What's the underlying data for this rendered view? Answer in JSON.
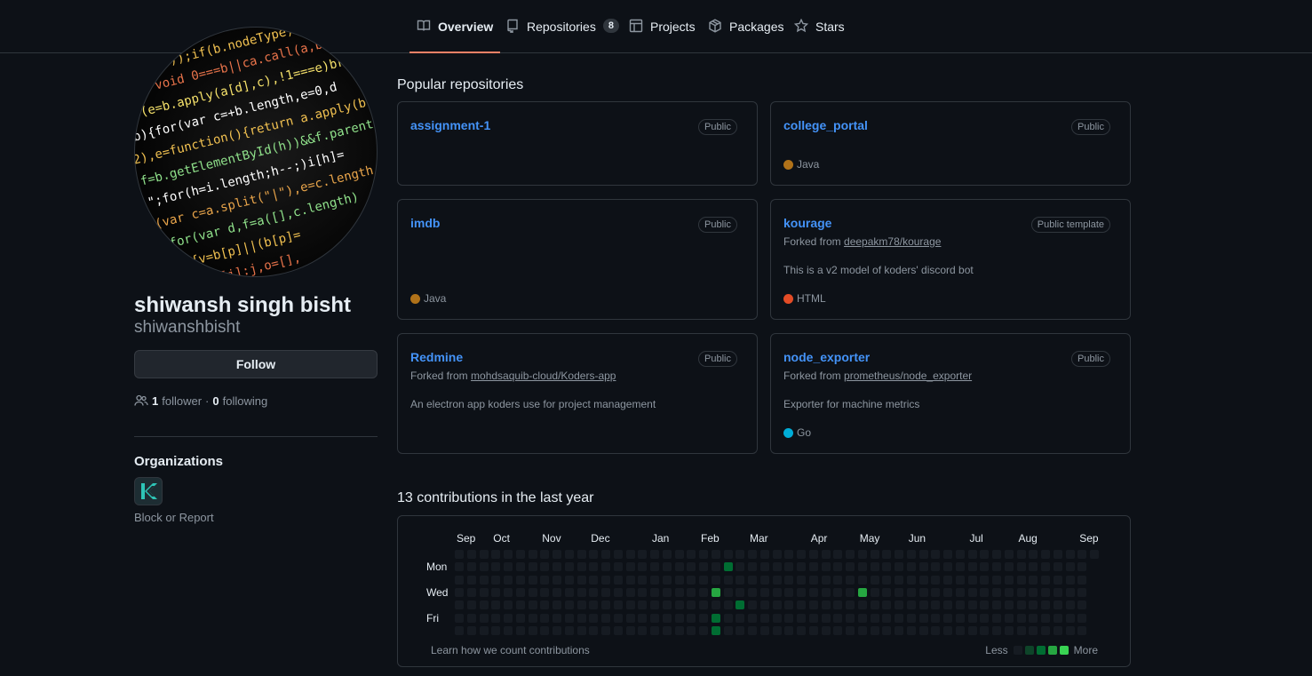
{
  "nav": {
    "tabs": [
      {
        "label": "Overview",
        "icon": "book-icon",
        "active": true
      },
      {
        "label": "Repositories",
        "icon": "repo-icon",
        "count": "8"
      },
      {
        "label": "Projects",
        "icon": "table-icon"
      },
      {
        "label": "Packages",
        "icon": "package-icon"
      },
      {
        "label": "Stars",
        "icon": "star-icon"
      }
    ]
  },
  "profile": {
    "fullname": "shiwansh singh bisht",
    "username": "shiwanshbisht",
    "follow_label": "Follow",
    "followers_count": "1",
    "followers_label": "follower",
    "separator": "·",
    "following_count": "0",
    "following_label": "following",
    "organizations_title": "Organizations",
    "block_report": "Block or Report"
  },
  "popular": {
    "title": "Popular repositories",
    "repos": [
      {
        "name": "assignment-1",
        "visibility": "Public",
        "fork_prefix": "",
        "fork_source": "",
        "description": "",
        "language": "",
        "lang_color": ""
      },
      {
        "name": "college_portal",
        "visibility": "Public",
        "fork_prefix": "",
        "fork_source": "",
        "description": "",
        "language": "Java",
        "lang_color": "#b07219"
      },
      {
        "name": "imdb",
        "visibility": "Public",
        "fork_prefix": "",
        "fork_source": "",
        "description": "",
        "language": "Java",
        "lang_color": "#b07219"
      },
      {
        "name": "kourage",
        "visibility": "Public template",
        "fork_prefix": "Forked from",
        "fork_source": "deepakm78/kourage",
        "description": "This is a v2 model of koders' discord bot",
        "language": "HTML",
        "lang_color": "#e34c26"
      },
      {
        "name": "Redmine",
        "visibility": "Public",
        "fork_prefix": "Forked from",
        "fork_source": "mohdsaquib-cloud/Koders-app",
        "description": "An electron app koders use for project management",
        "language": "",
        "lang_color": ""
      },
      {
        "name": "node_exporter",
        "visibility": "Public",
        "fork_prefix": "Forked from",
        "fork_source": "prometheus/node_exporter",
        "description": "Exporter for machine metrics",
        "language": "Go",
        "lang_color": "#00ADD8"
      }
    ]
  },
  "contributions": {
    "title": "13 contributions in the last year",
    "months": [
      "Sep",
      "Oct",
      "Nov",
      "Dec",
      "Jan",
      "Feb",
      "Mar",
      "Apr",
      "May",
      "Jun",
      "Jul",
      "Aug",
      "Sep"
    ],
    "days": [
      "Mon",
      "Wed",
      "Fri"
    ],
    "learn_link": "Learn how we count contributions",
    "legend_less": "Less",
    "legend_more": "More",
    "weeks": 53,
    "active_cells": [
      {
        "week": 21,
        "day": 3,
        "level": 3
      },
      {
        "week": 21,
        "day": 5,
        "level": 2
      },
      {
        "week": 21,
        "day": 6,
        "level": 2
      },
      {
        "week": 22,
        "day": 1,
        "level": 2
      },
      {
        "week": 23,
        "day": 4,
        "level": 2
      },
      {
        "week": 33,
        "day": 3,
        "level": 3
      }
    ],
    "level_colors": [
      "#161b22",
      "#0e4429",
      "#006d32",
      "#26a641",
      "#39d353"
    ]
  }
}
